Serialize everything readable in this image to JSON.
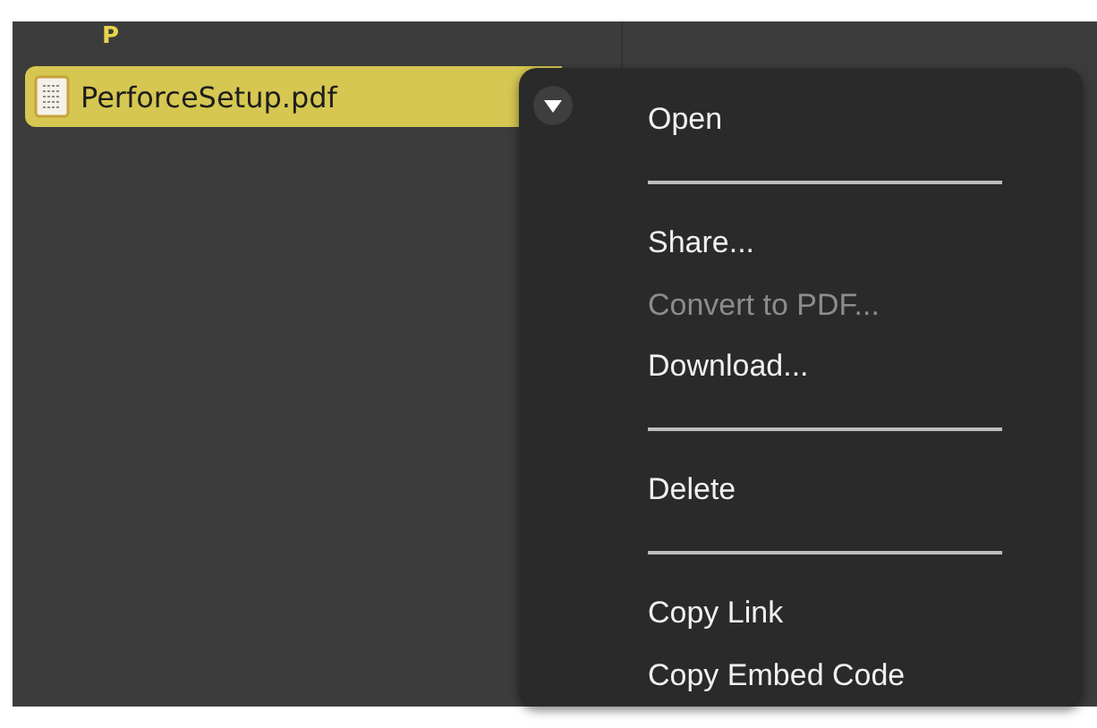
{
  "group_header": "P",
  "files": [
    {
      "name": "PerforceSetup.pdf",
      "selected": true
    }
  ],
  "menu": {
    "items": [
      {
        "kind": "item",
        "label": "Open",
        "disabled": false
      },
      {
        "kind": "separator"
      },
      {
        "kind": "item",
        "label": "Share...",
        "disabled": false
      },
      {
        "kind": "item",
        "label": "Convert to PDF...",
        "disabled": true
      },
      {
        "kind": "item",
        "label": "Download...",
        "disabled": false
      },
      {
        "kind": "separator"
      },
      {
        "kind": "item",
        "label": "Delete",
        "disabled": false
      },
      {
        "kind": "separator"
      },
      {
        "kind": "item",
        "label": "Copy Link",
        "disabled": false
      },
      {
        "kind": "item",
        "label": "Copy Embed Code",
        "disabled": false
      }
    ]
  }
}
